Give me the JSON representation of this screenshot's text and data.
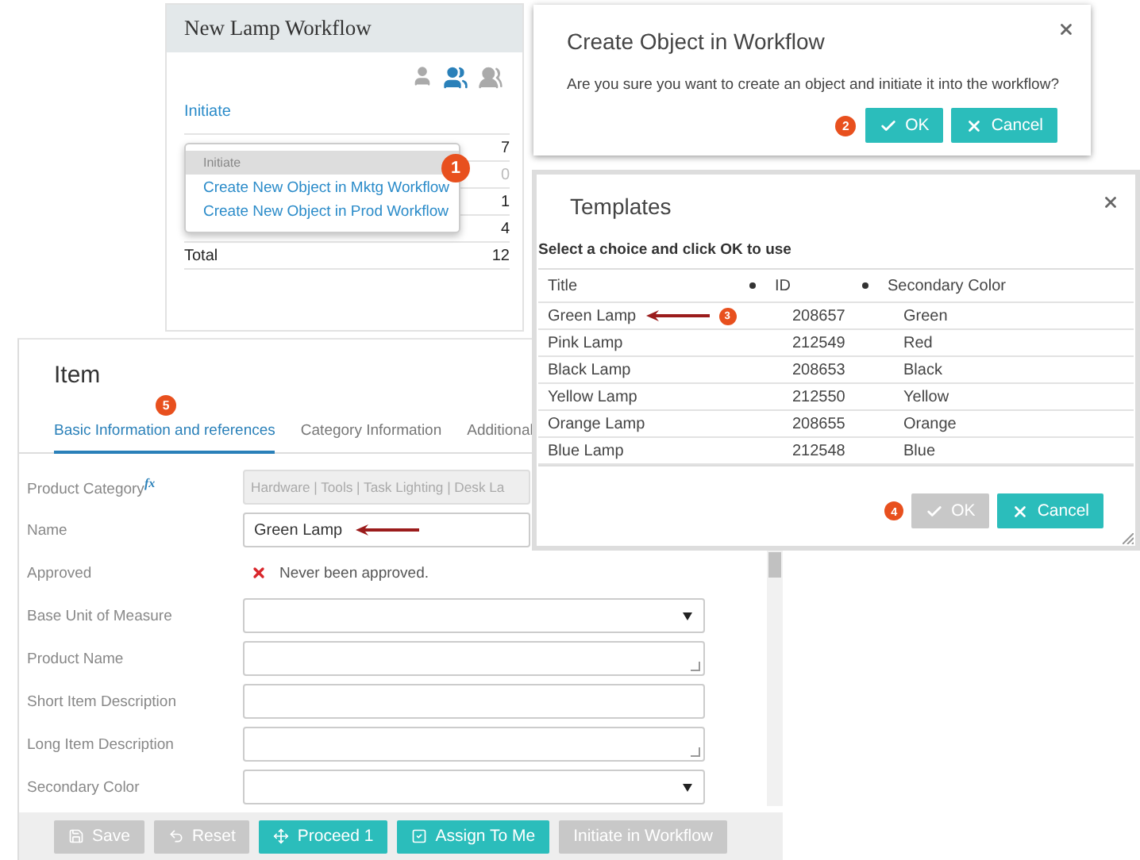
{
  "workflow_panel": {
    "title": "New Lamp Workflow",
    "people_icons": [
      {
        "kind": "single",
        "selected": false
      },
      {
        "kind": "pair",
        "selected": true
      },
      {
        "kind": "group",
        "selected": false
      }
    ],
    "initiate_link": "Initiate",
    "rows": [
      {
        "value": "7",
        "muted": false
      },
      {
        "value": "0",
        "muted": true
      },
      {
        "value": "1",
        "muted": false
      },
      {
        "value": "4",
        "muted": false
      }
    ],
    "total": {
      "label": "Total",
      "value": "12"
    },
    "menu": {
      "header": "Initiate",
      "items": [
        "Create New Object in Mktg Workflow",
        "Create New Object in Prod Workflow"
      ],
      "badge": "1"
    }
  },
  "create_dialog": {
    "title": "Create Object in Workflow",
    "message": "Are you sure you want to create an object and initiate it into the workflow?",
    "badge": "2",
    "buttons": [
      {
        "kind": "ok",
        "label": "OK",
        "disabled": false
      },
      {
        "kind": "cancel",
        "label": "Cancel",
        "disabled": false
      }
    ]
  },
  "templates_dialog": {
    "title": "Templates",
    "instruction": "Select a choice and click OK to use",
    "columns": [
      "Title",
      "ID",
      "Secondary Color"
    ],
    "rows": [
      {
        "title": "Green Lamp",
        "id": "208657",
        "secondary_color": "Green",
        "callout": "3"
      },
      {
        "title": "Pink Lamp",
        "id": "212549",
        "secondary_color": "Red"
      },
      {
        "title": "Black Lamp",
        "id": "208653",
        "secondary_color": "Black"
      },
      {
        "title": "Yellow Lamp",
        "id": "212550",
        "secondary_color": "Yellow"
      },
      {
        "title": "Orange Lamp",
        "id": "208655",
        "secondary_color": "Orange"
      },
      {
        "title": "Blue Lamp",
        "id": "212548",
        "secondary_color": "Blue"
      }
    ],
    "badge": "4",
    "buttons": [
      {
        "kind": "ok",
        "label": "OK",
        "disabled": true
      },
      {
        "kind": "cancel",
        "label": "Cancel",
        "disabled": false
      }
    ]
  },
  "item_panel": {
    "title": "Item",
    "badge": "5",
    "tabs": [
      {
        "label": "Basic Information and references",
        "selected": true
      },
      {
        "label": "Category Information",
        "selected": false
      },
      {
        "label": "Additional",
        "selected": false
      }
    ],
    "fields": [
      {
        "label": "Product Category",
        "formula_mark": "fx",
        "kind": "readonly",
        "value": "Hardware | Tools | Task Lighting | Desk La"
      },
      {
        "label": "Name",
        "kind": "text",
        "value": "Green Lamp",
        "arrow": true
      },
      {
        "label": "Approved",
        "kind": "status",
        "value": "Never been approved."
      },
      {
        "label": "Base Unit of Measure",
        "kind": "select"
      },
      {
        "label": "Product Name",
        "kind": "textarea"
      },
      {
        "label": "Short Item Description",
        "kind": "text"
      },
      {
        "label": "Long Item Description",
        "kind": "textarea"
      },
      {
        "label": "Secondary Color",
        "kind": "select"
      }
    ],
    "actions": [
      {
        "label": "Save",
        "kind": "save",
        "disabled": true
      },
      {
        "label": "Reset",
        "kind": "reset",
        "disabled": true
      },
      {
        "label": "Proceed 1",
        "kind": "proceed",
        "disabled": false
      },
      {
        "label": "Assign To Me",
        "kind": "assign",
        "disabled": false
      },
      {
        "label": "Initiate in Workflow",
        "kind": "plain",
        "disabled": true
      }
    ]
  }
}
